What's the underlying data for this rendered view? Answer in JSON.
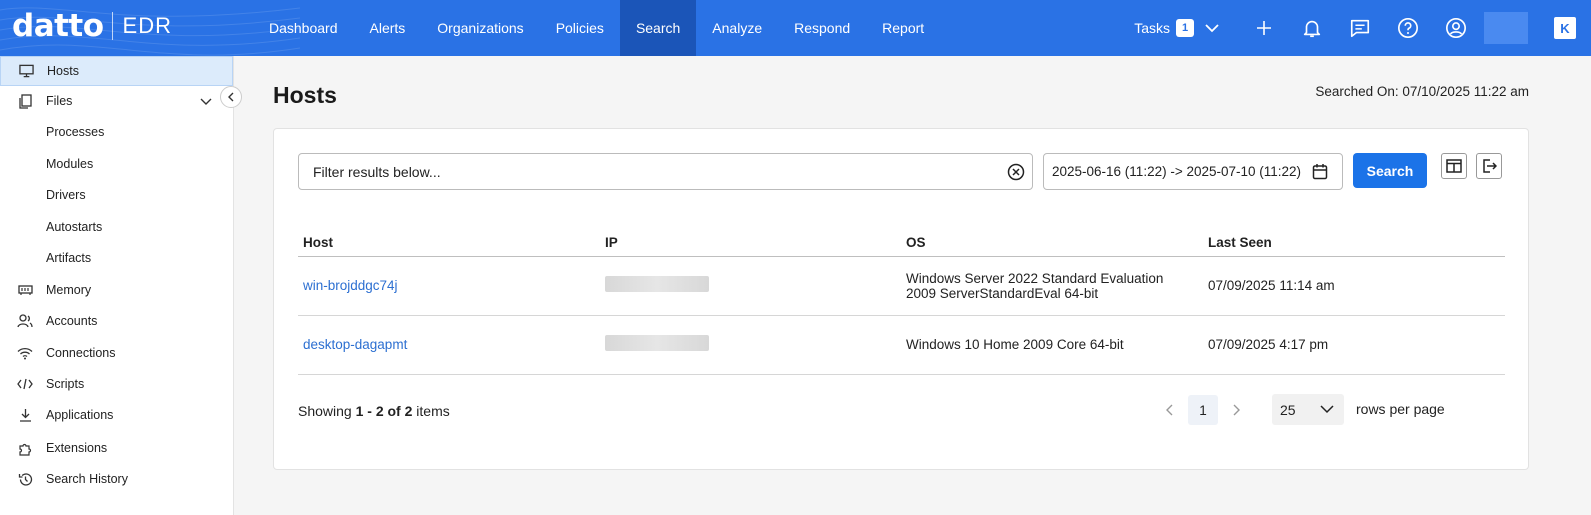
{
  "header": {
    "brand": "datto",
    "product": "EDR",
    "nav": [
      "Dashboard",
      "Alerts",
      "Organizations",
      "Policies",
      "Search",
      "Analyze",
      "Respond",
      "Report"
    ],
    "active_nav": "Search",
    "tasks_label": "Tasks",
    "tasks_count": "1",
    "icons": [
      "chevron-down-icon",
      "plus-icon",
      "bell-icon",
      "chat-icon",
      "help-icon",
      "user-icon",
      "kaseya-icon"
    ]
  },
  "sidebar": {
    "items": [
      {
        "label": "Hosts",
        "icon": "monitor-icon"
      },
      {
        "label": "Files",
        "icon": "files-icon"
      },
      {
        "label": "Processes"
      },
      {
        "label": "Modules"
      },
      {
        "label": "Drivers"
      },
      {
        "label": "Autostarts"
      },
      {
        "label": "Artifacts"
      },
      {
        "label": "Memory",
        "icon": "memory-icon"
      },
      {
        "label": "Accounts",
        "icon": "accounts-icon"
      },
      {
        "label": "Connections",
        "icon": "wifi-icon"
      },
      {
        "label": "Scripts",
        "icon": "code-icon"
      },
      {
        "label": "Applications",
        "icon": "download-icon"
      },
      {
        "label": "Extensions",
        "icon": "puzzle-icon"
      },
      {
        "label": "Search History",
        "icon": "history-icon"
      }
    ]
  },
  "main": {
    "title": "Hosts",
    "searched_on": "Searched On: 07/10/2025 11:22 am",
    "filter_placeholder": "Filter results below...",
    "date_range": "2025-06-16 (11:22) -> 2025-07-10 (11:22)",
    "search_label": "Search",
    "columns": [
      "Host",
      "IP",
      "OS",
      "Last Seen"
    ],
    "rows": [
      {
        "host": "win-brojddgc74j",
        "os_line1": "Windows Server 2022 Standard Evaluation",
        "os_line2": "2009 ServerStandardEval 64-bit",
        "last_seen": "07/09/2025 11:14 am"
      },
      {
        "host": "desktop-dagapmt",
        "os_line1": "Windows 10 Home 2009 Core 64-bit",
        "os_line2": "",
        "last_seen": "07/09/2025 4:17 pm"
      }
    ],
    "showing_prefix": "Showing ",
    "showing_range": "1 - 2 of 2",
    "showing_suffix": " items",
    "page": "1",
    "rows_per_page": "25",
    "rows_per_page_label": "rows per page"
  },
  "colors": {
    "topbar": "#2a72e5",
    "accent": "#1b73e8",
    "link": "#2c6fd1"
  }
}
